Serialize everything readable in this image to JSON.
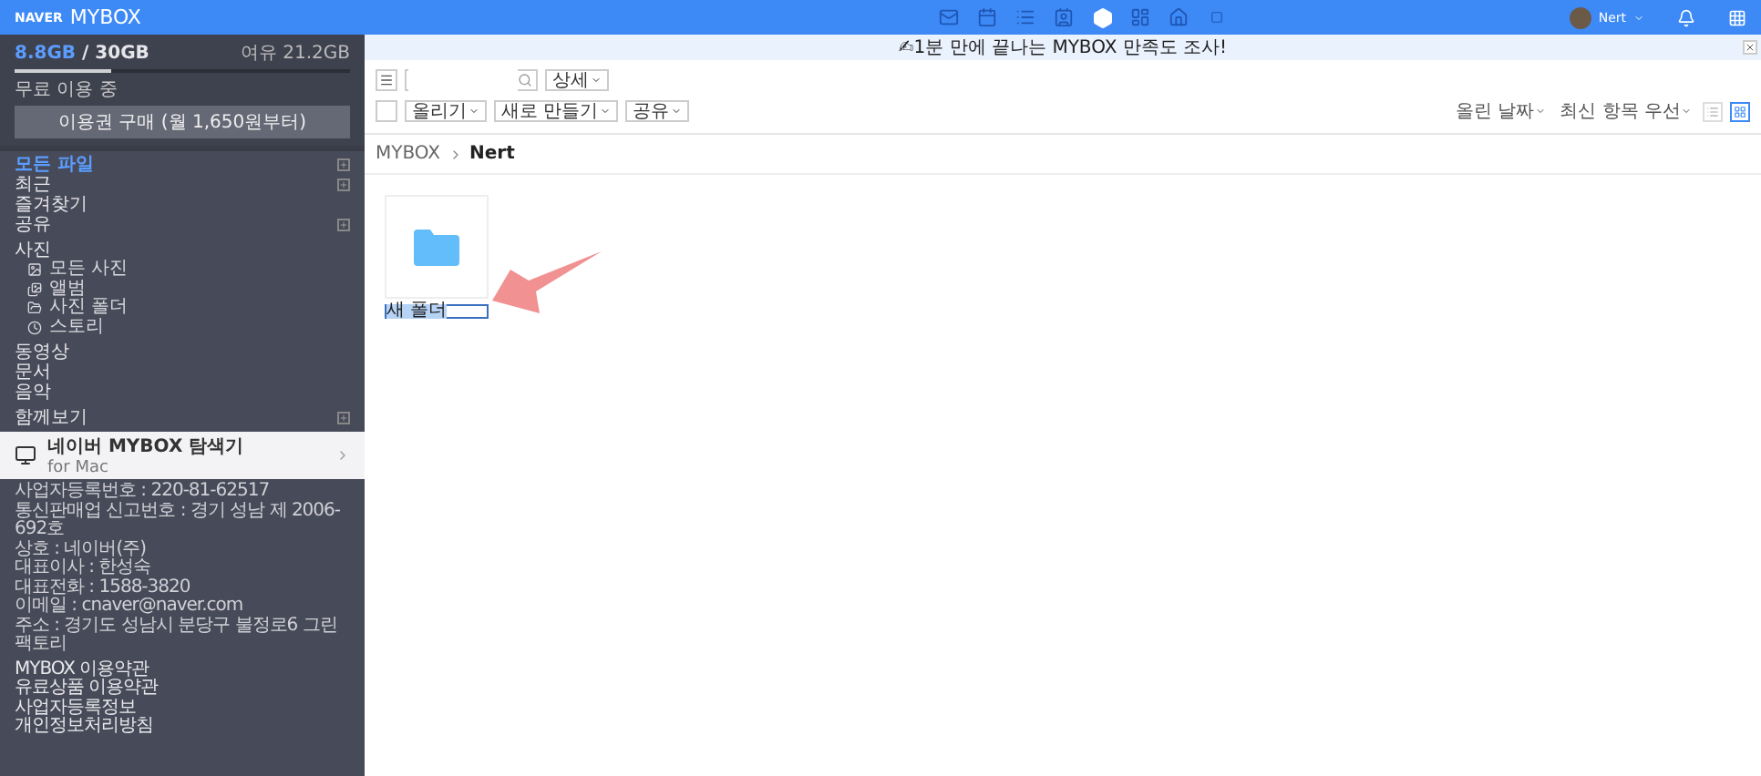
{
  "header": {
    "logo_brand": "NAVER",
    "logo_product": "MYBOX",
    "user": "Nert"
  },
  "top_apps": [
    {
      "kind": "mail",
      "selected": false
    },
    {
      "kind": "calendar",
      "selected": false
    },
    {
      "kind": "list",
      "selected": false
    },
    {
      "kind": "contacts",
      "selected": false
    },
    {
      "kind": "mybox",
      "selected": true
    },
    {
      "kind": "note",
      "selected": false
    },
    {
      "kind": "home",
      "selected": false
    },
    {
      "kind": "square",
      "selected": false
    }
  ],
  "banner": {
    "text": "✍1분 만에 끝나는 MYBOX 만족도 조사!"
  },
  "storage": {
    "used": "8.8GB",
    "total": "30GB",
    "separator": "/",
    "remaining": "여유 21.2GB",
    "level": 0.29,
    "plan": "무료 이용 중",
    "buy_button": "이용권 구매 (월 1,650원부터)"
  },
  "sidebar": {
    "groups": [
      {
        "items": [
          {
            "label": "모든 파일",
            "selected": true,
            "expandable": true
          },
          {
            "label": "최근",
            "selected": false,
            "expandable": true
          },
          {
            "label": "즐겨찾기",
            "selected": false,
            "expandable": false
          },
          {
            "label": "공유",
            "selected": false,
            "expandable": true
          }
        ]
      },
      {
        "title": "사진",
        "items": [
          {
            "label": "모든 사진",
            "selected": false,
            "kind": "photo"
          },
          {
            "label": "앨범",
            "selected": false,
            "kind": "album"
          },
          {
            "label": "사진 폴더",
            "selected": false,
            "kind": "folder"
          },
          {
            "label": "스토리",
            "selected": false,
            "kind": "story"
          }
        ]
      },
      {
        "items": [
          {
            "label": "동영상",
            "selected": false,
            "expandable": false
          },
          {
            "label": "문서",
            "selected": false,
            "expandable": false
          },
          {
            "label": "음악",
            "selected": false,
            "expandable": false
          }
        ]
      },
      {
        "items": [
          {
            "label": "함께보기",
            "selected": false,
            "expandable": true
          }
        ]
      }
    ]
  },
  "promo": {
    "title": "네이버 MYBOX 탐색기",
    "subtitle": "for Mac"
  },
  "footer": {
    "info": [
      "사업자등록번호 : 220-81-62517",
      "통신판매업 신고번호 : 경기 성남 제 2006-692호",
      "상호 : 네이버(주)",
      "대표이사 : 한성숙",
      "대표전화 : 1588-3820",
      "이메일 : cnaver@naver.com",
      "주소 : 경기도 성남시 분당구 불정로6 그린팩토리"
    ],
    "links": [
      "MYBOX 이용약관",
      "유료상품 이용약관",
      "사업자등록정보",
      "개인정보처리방침"
    ]
  },
  "toolbar": {
    "search": {
      "detail": "상세"
    },
    "select_all": {
      "checked": false
    },
    "actions": [
      "올리기",
      "새로 만들기",
      "공유"
    ],
    "sort_fields": [
      "올린 날짜",
      "최신 항목 우선"
    ],
    "views": [
      {
        "kind": "list",
        "selected": false
      },
      {
        "kind": "grid",
        "selected": true
      }
    ]
  },
  "breadcrumb": [
    "MYBOX",
    "Nert"
  ],
  "items": [
    {
      "kind": "folder",
      "name": "새 폴더",
      "editing": true
    }
  ]
}
